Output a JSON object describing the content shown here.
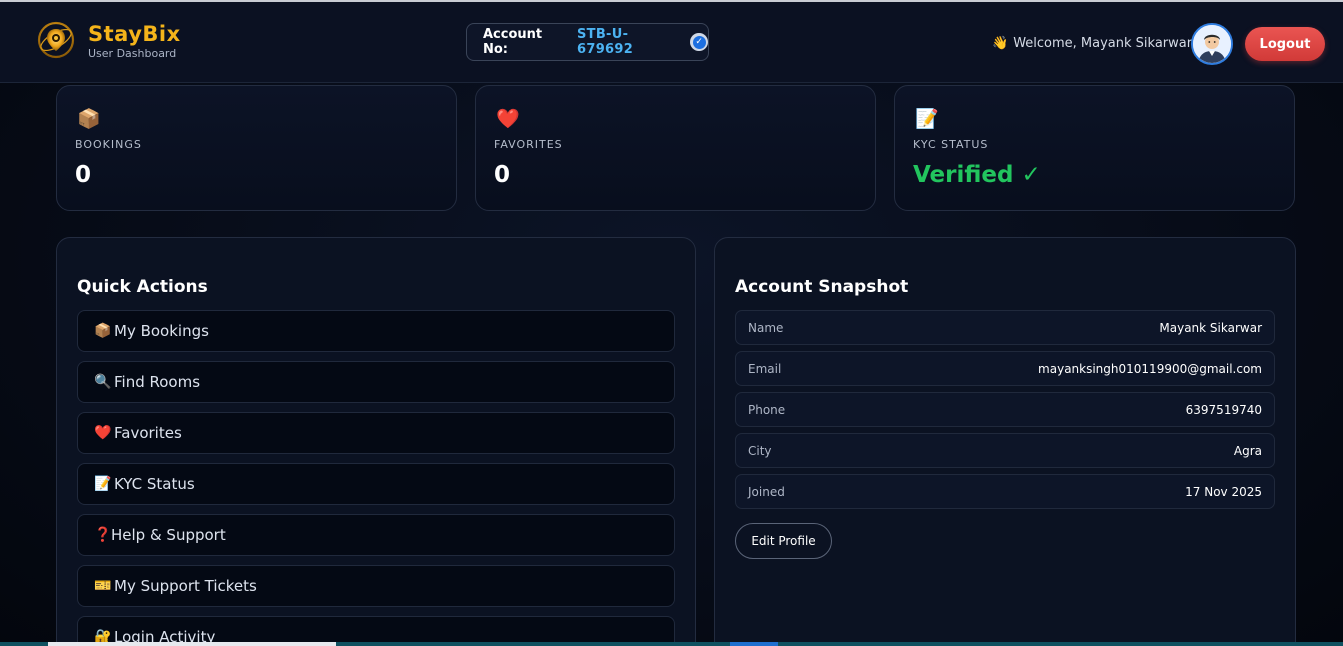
{
  "header": {
    "brand_name": "StayBix",
    "brand_sub": "User Dashboard",
    "account_label": "Account No:",
    "account_value": "STB-U-679692",
    "welcome_icon": "👋",
    "welcome_text": "Welcome, Mayank Sikarwar",
    "logout_label": "Logout"
  },
  "stats": [
    {
      "icon": "📦",
      "label": "BOOKINGS",
      "value": "0"
    },
    {
      "icon": "❤️",
      "label": "FAVORITES",
      "value": "0"
    },
    {
      "icon": "📝",
      "label": "KYC STATUS",
      "value": "Verified ✓"
    }
  ],
  "quick_actions": {
    "title": "Quick Actions",
    "items": [
      {
        "icon": "📦",
        "label": "My Bookings"
      },
      {
        "icon": "🔍",
        "label": "Find Rooms"
      },
      {
        "icon": "❤️",
        "label": "Favorites"
      },
      {
        "icon": "📝",
        "label": "KYC Status"
      },
      {
        "icon": "❓",
        "label": "Help & Support"
      },
      {
        "icon": "🎫",
        "label": "My Support Tickets"
      },
      {
        "icon": "🔐",
        "label": "Login Activity"
      }
    ]
  },
  "snapshot": {
    "title": "Account Snapshot",
    "rows": [
      {
        "key": "Name",
        "value": "Mayank Sikarwar"
      },
      {
        "key": "Email",
        "value": "mayanksingh010119900@gmail.com"
      },
      {
        "key": "Phone",
        "value": "6397519740"
      },
      {
        "key": "City",
        "value": "Agra"
      },
      {
        "key": "Joined",
        "value": "17 Nov 2025"
      }
    ],
    "edit_label": "Edit Profile"
  },
  "colors": {
    "brand": "#f4b41a",
    "account_value": "#4cb3f2",
    "verified": "#22c55e",
    "logout": "#e04846"
  }
}
